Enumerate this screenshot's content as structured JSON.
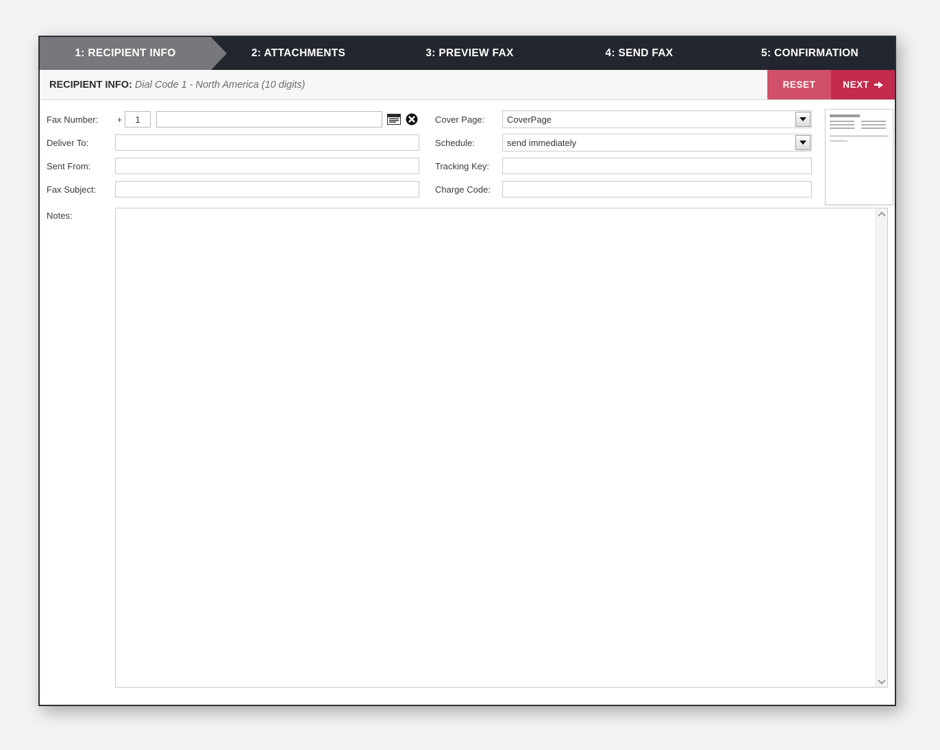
{
  "steps": [
    {
      "label": "1: RECIPIENT INFO",
      "active": true
    },
    {
      "label": "2: ATTACHMENTS",
      "active": false
    },
    {
      "label": "3: PREVIEW FAX",
      "active": false
    },
    {
      "label": "4: SEND FAX",
      "active": false
    },
    {
      "label": "5: CONFIRMATION",
      "active": false
    }
  ],
  "sub_header": {
    "title": "RECIPIENT INFO:",
    "detail": "Dial Code 1 - North America (10 digits)"
  },
  "actions": {
    "reset_label": "RESET",
    "next_label": "NEXT"
  },
  "form": {
    "left": {
      "fax_number": {
        "label": "Fax Number:",
        "plus": "+",
        "dial_code_value": "1",
        "dial_code_placeholder": "",
        "number_value": "",
        "number_placeholder": "",
        "addressbook_icon": "address-book-icon",
        "clear_icon": "clear-circle-icon"
      },
      "deliver_to": {
        "label": "Deliver To:",
        "value": "",
        "placeholder": ""
      },
      "sent_from": {
        "label": "Sent From:",
        "value": "",
        "placeholder": ""
      },
      "fax_subject": {
        "label": "Fax Subject:",
        "value": "",
        "placeholder": ""
      }
    },
    "right": {
      "cover_page": {
        "label": "Cover Page:",
        "value": "CoverPage",
        "options": [
          "CoverPage"
        ]
      },
      "schedule": {
        "label": "Schedule:",
        "value": "send immediately",
        "options": [
          "send immediately"
        ]
      },
      "tracking_key": {
        "label": "Tracking Key:",
        "value": "",
        "placeholder": ""
      },
      "charge_code": {
        "label": "Charge Code:",
        "value": "",
        "placeholder": ""
      }
    },
    "notes": {
      "label": "Notes:",
      "value": "",
      "placeholder": ""
    }
  },
  "thumbnail": {
    "name": "cover-page-preview"
  },
  "colors": {
    "tabbar_bg": "#22262e",
    "active_tab": "#76787b",
    "reset_bg": "#d05069",
    "next_bg": "#c32a4c",
    "frame_border": "#2b2f36",
    "page_bg": "#f2f2f2"
  }
}
